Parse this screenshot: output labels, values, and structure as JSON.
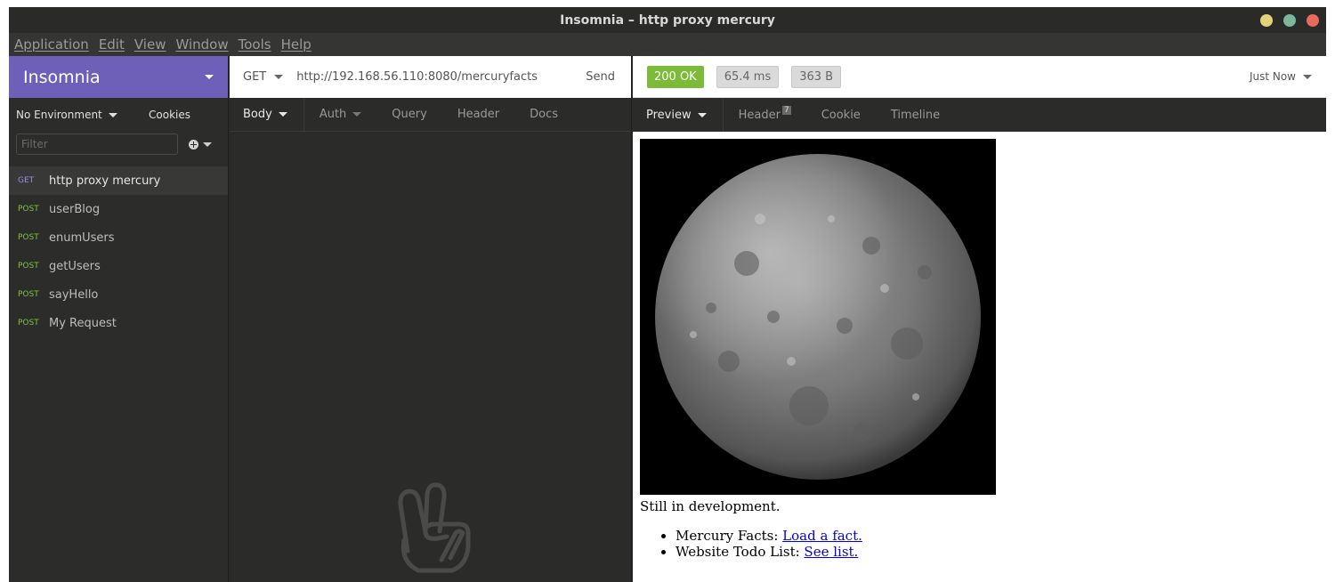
{
  "window": {
    "title": "Insomnia – http proxy mercury",
    "buttons": {
      "minimize_color": "#e2d37a",
      "maximize_color": "#7cb79c",
      "close_color": "#e86a5f"
    }
  },
  "menubar": [
    "Application",
    "Edit",
    "View",
    "Window",
    "Tools",
    "Help"
  ],
  "sidebar": {
    "workspace": "Insomnia",
    "environment": "No Environment",
    "cookies": "Cookies",
    "filter_placeholder": "Filter",
    "requests": [
      {
        "method": "GET",
        "name": "http proxy mercury",
        "active": true
      },
      {
        "method": "POST",
        "name": "userBlog"
      },
      {
        "method": "POST",
        "name": "enumUsers"
      },
      {
        "method": "POST",
        "name": "getUsers"
      },
      {
        "method": "POST",
        "name": "sayHello"
      },
      {
        "method": "POST",
        "name": "My Request"
      }
    ]
  },
  "request": {
    "method": "GET",
    "url": "http://192.168.56.110:8080/mercuryfacts",
    "send": "Send",
    "tabs": [
      "Body",
      "Auth",
      "Query",
      "Header",
      "Docs"
    ],
    "empty_icon": "peace-hand-icon"
  },
  "response": {
    "status": "200 OK",
    "time": "65.4 ms",
    "size": "363 B",
    "history": "Just Now",
    "tabs": [
      "Preview",
      "Header",
      "Cookie",
      "Timeline"
    ],
    "header_count": "7",
    "preview": {
      "image": "mercury-planet",
      "text": "Still in development.",
      "list": [
        {
          "label": "Mercury Facts: ",
          "link": "Load a fact."
        },
        {
          "label": "Website Todo List: ",
          "link": "See list."
        }
      ]
    }
  },
  "colors": {
    "accent": "#6e5fb8",
    "status_ok": "#7cbb38",
    "get_method": "#9b8ee0",
    "post_method": "#7cc243"
  }
}
